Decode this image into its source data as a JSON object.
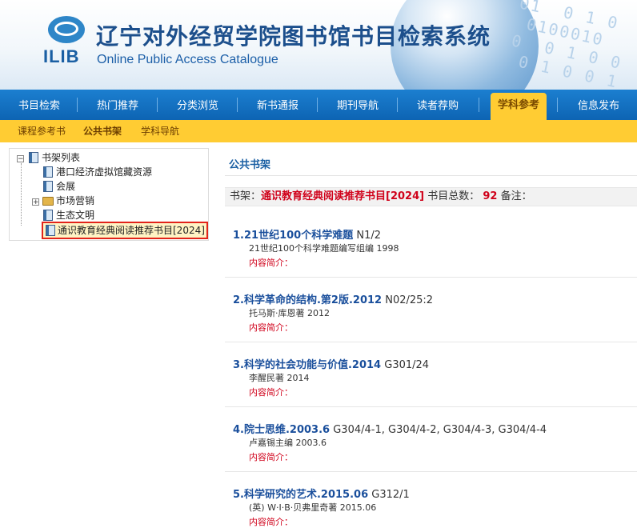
{
  "header": {
    "logo_text": "ILIB",
    "title_cn": "辽宁对外经贸学院图书馆书目检索系统",
    "title_en": "Online Public Access Catalogue"
  },
  "nav": {
    "items": [
      {
        "label": "书目检索"
      },
      {
        "label": "热门推荐"
      },
      {
        "label": "分类浏览"
      },
      {
        "label": "新书通报"
      },
      {
        "label": "期刊导航"
      },
      {
        "label": "读者荐购"
      },
      {
        "label": "学科参考",
        "active": true
      },
      {
        "label": "信息发布"
      }
    ]
  },
  "subnav": {
    "items": [
      {
        "label": "课程参考书"
      },
      {
        "label": "公共书架",
        "active": true
      },
      {
        "label": "学科导航"
      }
    ]
  },
  "tree": {
    "root": "书架列表",
    "items": [
      {
        "label": "港口经济虚拟馆藏资源"
      },
      {
        "label": "会展"
      },
      {
        "label": "市场营销"
      },
      {
        "label": "生态文明"
      },
      {
        "label": "通识教育经典阅读推荐书目[2024]",
        "selected": true
      }
    ]
  },
  "content": {
    "title": "公共书架",
    "shelf_label": "书架：",
    "shelf_name": "通识教育经典阅读推荐书目[2024]",
    "total_label": "书目总数：",
    "total": "92",
    "note_label": "备注：",
    "books": [
      {
        "title": "1.21世纪100个科学难题",
        "call": "N1/2",
        "author": "21世纪100个科学难题编写组编  1998",
        "summary_label": "内容简介："
      },
      {
        "title": "2.科学革命的结构.第2版.2012",
        "call": "N02/25:2",
        "author": "托马斯·库恩著  2012",
        "summary_label": "内容简介："
      },
      {
        "title": "3.科学的社会功能与价值.2014",
        "call": "G301/24",
        "author": "李醒民著  2014",
        "summary_label": "内容简介："
      },
      {
        "title": "4.院士思维.2003.6",
        "call": "G304/4-1, G304/4-2, G304/4-3, G304/4-4",
        "author": "卢嘉锡主编  2003.6",
        "summary_label": "内容简介："
      },
      {
        "title": "5.科学研究的艺术.2015.06",
        "call": "G312/1",
        "author": "(英) W·I·B·贝弗里奇著  2015.06",
        "summary_label": "内容简介："
      }
    ]
  }
}
